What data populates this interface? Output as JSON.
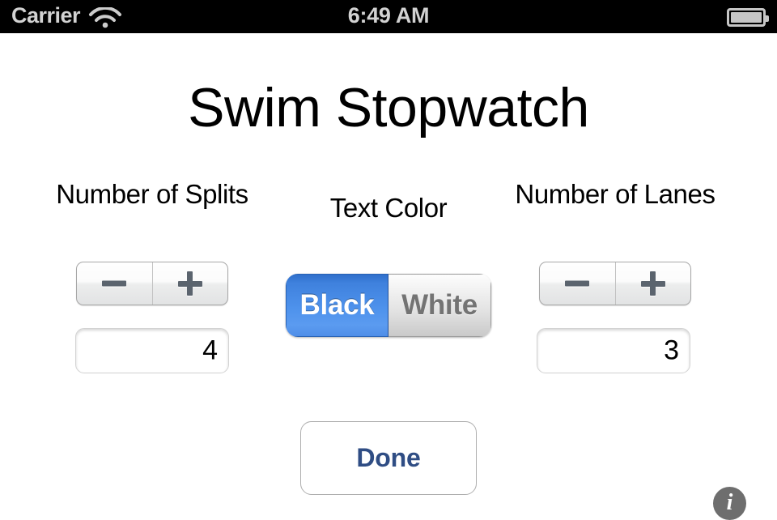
{
  "status_bar": {
    "carrier": "Carrier",
    "wifi_icon": "wifi-icon",
    "time": "6:49 AM",
    "battery_icon": "battery-full-icon"
  },
  "app": {
    "title": "Swim Stopwatch"
  },
  "settings": {
    "splits": {
      "label": "Number of Splits",
      "value": "4",
      "decrement_label": "minus-icon",
      "increment_label": "plus-icon"
    },
    "lanes": {
      "label": "Number of Lanes",
      "value": "3",
      "decrement_label": "minus-icon",
      "increment_label": "plus-icon"
    },
    "text_color": {
      "label": "Text Color",
      "options": [
        "Black",
        "White"
      ],
      "selected": "Black",
      "selected_color": "#4e92ec"
    }
  },
  "actions": {
    "done_label": "Done",
    "done_text_color": "#2f4d84",
    "info_label": "i"
  }
}
